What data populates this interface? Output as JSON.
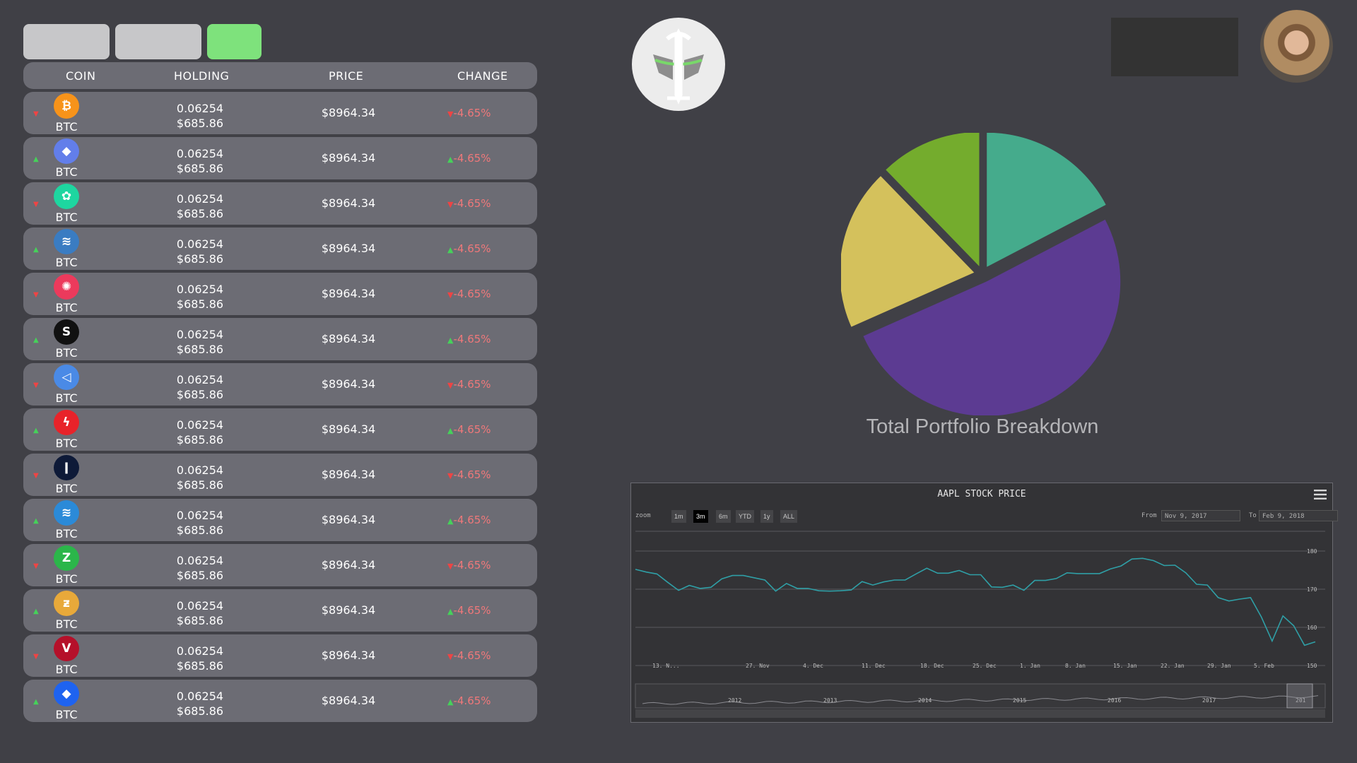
{
  "table": {
    "headers": [
      "COIN",
      "HOLDING",
      "PRICE",
      "CHANGE"
    ],
    "rows": [
      {
        "trend": "down",
        "symbol": "BTC",
        "icon": "bitcoin-icon",
        "color": "#f7931a",
        "glyph": "₿",
        "holding": "0.06254",
        "value": "$685.86",
        "price": "$8964.34",
        "change": "▼-4.65%"
      },
      {
        "trend": "up",
        "symbol": "BTC",
        "icon": "ethereum-icon",
        "color": "#627eea",
        "glyph": "◆",
        "holding": "0.06254",
        "value": "$685.86",
        "price": "$8964.34",
        "change": "▲-4.65%"
      },
      {
        "trend": "down",
        "symbol": "BTC",
        "icon": "coin-icon",
        "color": "#1ed6a0",
        "glyph": "✿",
        "holding": "0.06254",
        "value": "$685.86",
        "price": "$8964.34",
        "change": "▼-4.65%"
      },
      {
        "trend": "up",
        "symbol": "BTC",
        "icon": "globe-icon",
        "color": "#3a7cc2",
        "glyph": "≋",
        "holding": "0.06254",
        "value": "$685.86",
        "price": "$8964.34",
        "change": "▲-4.65%"
      },
      {
        "trend": "down",
        "symbol": "BTC",
        "icon": "fun-icon",
        "color": "#ec3a5c",
        "glyph": "✺",
        "holding": "0.06254",
        "value": "$685.86",
        "price": "$8964.34",
        "change": "▼-4.65%"
      },
      {
        "trend": "up",
        "symbol": "BTC",
        "icon": "cube-icon",
        "color": "#111111",
        "glyph": "S",
        "holding": "0.06254",
        "value": "$685.86",
        "price": "$8964.34",
        "change": "▲-4.65%"
      },
      {
        "trend": "down",
        "symbol": "BTC",
        "icon": "send-icon",
        "color": "#4a8ae6",
        "glyph": "◁",
        "holding": "0.06254",
        "value": "$685.86",
        "price": "$8964.34",
        "change": "▼-4.65%"
      },
      {
        "trend": "up",
        "symbol": "BTC",
        "icon": "flame-icon",
        "color": "#e8232a",
        "glyph": "ϟ",
        "holding": "0.06254",
        "value": "$685.86",
        "price": "$8964.34",
        "change": "▲-4.65%"
      },
      {
        "trend": "down",
        "symbol": "BTC",
        "icon": "figure-icon",
        "color": "#0e1a38",
        "glyph": "ǀ",
        "holding": "0.06254",
        "value": "$685.86",
        "price": "$8964.34",
        "change": "▼-4.65%"
      },
      {
        "trend": "up",
        "symbol": "BTC",
        "icon": "steem-icon",
        "color": "#2b8ad8",
        "glyph": "≋",
        "holding": "0.06254",
        "value": "$685.86",
        "price": "$8964.34",
        "change": "▲-4.65%"
      },
      {
        "trend": "down",
        "symbol": "BTC",
        "icon": "zcoin-icon",
        "color": "#2bb64a",
        "glyph": "Z",
        "holding": "0.06254",
        "value": "$685.86",
        "price": "$8964.34",
        "change": "▼-4.65%"
      },
      {
        "trend": "up",
        "symbol": "BTC",
        "icon": "zcash-icon",
        "color": "#e8a93a",
        "glyph": "ƶ",
        "holding": "0.06254",
        "value": "$685.86",
        "price": "$8964.34",
        "change": "▲-4.65%"
      },
      {
        "trend": "down",
        "symbol": "BTC",
        "icon": "vcoin-icon",
        "color": "#b5102a",
        "glyph": "V",
        "holding": "0.06254",
        "value": "$685.86",
        "price": "$8964.34",
        "change": "▼-4.65%"
      },
      {
        "trend": "up",
        "symbol": "BTC",
        "icon": "diamond-icon",
        "color": "#1e63f0",
        "glyph": "◆",
        "holding": "0.06254",
        "value": "$685.86",
        "price": "$8964.34",
        "change": "▲-4.65%"
      }
    ]
  },
  "chart_data": [
    {
      "type": "pie",
      "title": "Total Portfolio Breakdown",
      "values": [
        17,
        50,
        19,
        12
      ],
      "colors": [
        "#45ab8c",
        "#5c3b92",
        "#d4c15c",
        "#74ac2d"
      ]
    },
    {
      "type": "line",
      "title": "AAPL STOCK PRICE",
      "zoom_label": "zoom",
      "zoom_options": [
        "1m",
        "3m",
        "6m",
        "YTD",
        "1y",
        "ALL"
      ],
      "zoom_selected": "3m",
      "from_label": "From",
      "from_value": "Nov 9, 2017",
      "to_label": "To",
      "to_value": "Feb 9, 2018",
      "ylim": [
        150,
        180
      ],
      "yticks": [
        150,
        160,
        170,
        180
      ],
      "xtick_labels": [
        "13. N...",
        "27. Nov",
        "4. Dec",
        "11. Dec",
        "18. Dec",
        "25. Dec",
        "1. Jan",
        "8. Jan",
        "15. Jan",
        "22. Jan",
        "29. Jan",
        "5. Feb"
      ],
      "values": [
        175.2,
        174.5,
        174.0,
        171.8,
        169.7,
        171.0,
        170.2,
        170.5,
        172.7,
        173.6,
        173.6,
        173.0,
        172.4,
        169.5,
        171.5,
        170.2,
        170.2,
        169.6,
        169.5,
        169.6,
        169.8,
        172.0,
        171.1,
        171.9,
        172.4,
        172.4,
        174.0,
        175.5,
        174.2,
        174.2,
        174.9,
        173.8,
        173.8,
        170.6,
        170.5,
        171.1,
        169.7,
        172.3,
        172.3,
        172.8,
        174.3,
        174.1,
        174.1,
        174.1,
        175.3,
        176.1,
        177.9,
        178.1,
        177.5,
        176.2,
        176.3,
        174.3,
        171.3,
        171.1,
        167.8,
        166.9,
        167.4,
        167.8,
        162.7,
        156.4,
        163.0,
        160.4,
        155.3,
        156.2
      ],
      "navigator_labels": [
        "2012",
        "2013",
        "2014",
        "2015",
        "2016",
        "2017",
        "201"
      ]
    }
  ]
}
